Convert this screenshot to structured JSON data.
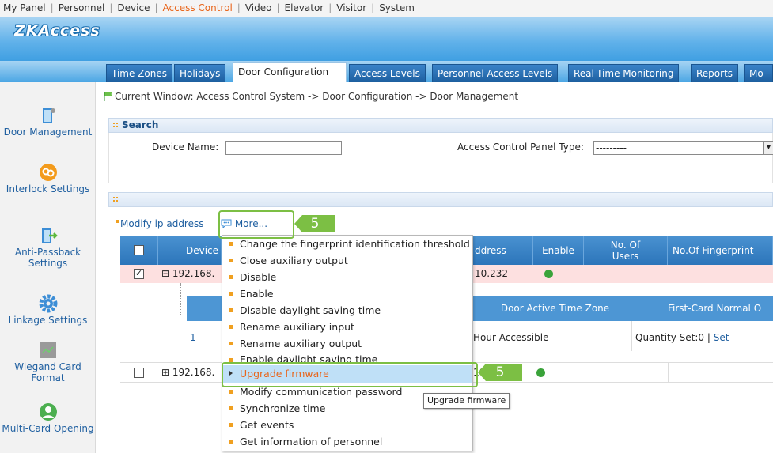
{
  "top_nav": {
    "items": [
      "My Panel",
      "Personnel",
      "Device",
      "Access Control",
      "Video",
      "Elevator",
      "Visitor",
      "System"
    ],
    "active": "Access Control"
  },
  "logo": "ZKAccess",
  "tabs": [
    "Time Zones",
    "Holidays",
    "Door Configuration",
    "Access Levels",
    "Personnel Access Levels",
    "Real-Time Monitoring",
    "Reports",
    "Mo"
  ],
  "active_tab": "Door Configuration",
  "sidebar": {
    "items": [
      {
        "label": "Door Management",
        "icon": "door-icon"
      },
      {
        "label": "Interlock Settings",
        "icon": "interlock-icon"
      },
      {
        "label": "Anti-Passback Settings",
        "icon": "anti-passback-icon"
      },
      {
        "label": "Linkage Settings",
        "icon": "gear-icon"
      },
      {
        "label": "Wiegand Card Format",
        "icon": "wiegand-icon"
      },
      {
        "label": "Multi-Card Opening",
        "icon": "multi-card-icon"
      }
    ]
  },
  "breadcrumb": "Current Window: Access Control System -> Door Configuration -> Door Management",
  "search": {
    "title": "Search",
    "device_name_label": "Device Name:",
    "device_name_value": "",
    "panel_type_label": "Access Control Panel Type:",
    "panel_type_value": "---------"
  },
  "actions": {
    "modify_ip": "Modify ip address",
    "more": "More..."
  },
  "grid": {
    "headers": [
      "Device",
      "ddress",
      "Enable",
      "No. Of Users",
      "No.Of Fingerprint"
    ],
    "rows": [
      {
        "device": "⊟ 192.168.",
        "address": "10.232",
        "checked": true
      },
      {
        "device": "⊞ 192.168.",
        "address": "10",
        "checked": false
      }
    ],
    "sub_headers": [
      "Door Active Time Zone",
      "First-Card Normal O"
    ],
    "sub_row": {
      "index": "1",
      "time_zone": "Hour Accessible",
      "first_card": "Quantity Set:0 | ",
      "set_link": "Set"
    }
  },
  "more_menu": {
    "items": [
      "Change the fingerprint identification threshold",
      "Close auxiliary output",
      "Disable",
      "Enable",
      "Disable daylight saving time",
      "Rename auxiliary input",
      "Rename auxiliary output",
      "Enable daylight saving time",
      "Upgrade firmware",
      "Modify communication password",
      "Synchronize time",
      "Get events",
      "Get information of personnel"
    ],
    "highlighted": "Upgrade firmware"
  },
  "tooltip": "Upgrade firmware",
  "callouts": [
    "5",
    "5"
  ],
  "colors": {
    "accent": "#e8651b",
    "highlight": "#7cbf44",
    "tab_blue": "#1d5f9f",
    "header_blue": "#2c75ba"
  }
}
